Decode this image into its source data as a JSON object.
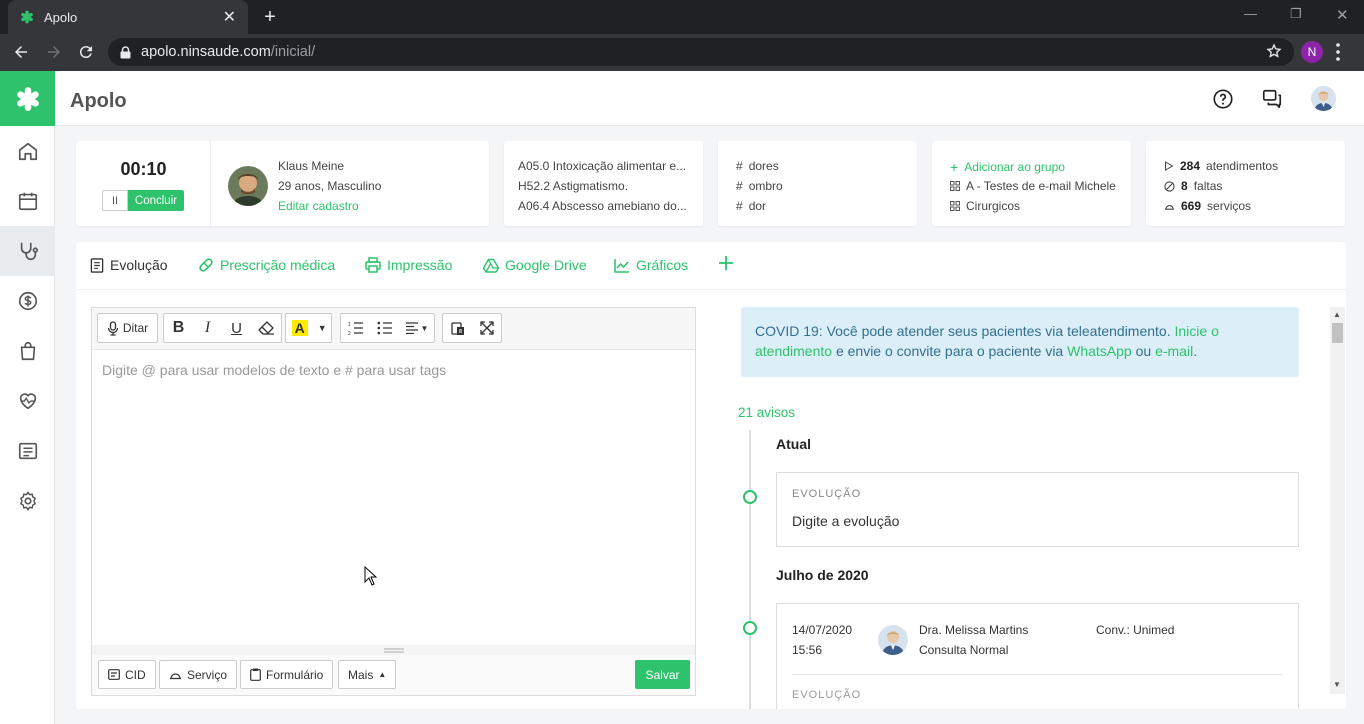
{
  "browser": {
    "tab_title": "Apolo",
    "url_host": "apolo.ninsaude.com",
    "url_path": "/inicial/",
    "profile_initial": "N"
  },
  "app": {
    "title": "Apolo",
    "sidebar": [
      "home-icon",
      "calendar-icon",
      "stethoscope-icon",
      "dollar-icon",
      "bag-icon",
      "heartbeat-icon",
      "document-list-icon",
      "gear-icon"
    ],
    "active_sidebar": "stethoscope-icon",
    "accent": "#2dc26b"
  },
  "timer": {
    "time": "00:10",
    "pause_label": "II",
    "finish_label": "Concluir"
  },
  "patient": {
    "name": "Klaus Meine",
    "info": "29 anos, Masculino",
    "edit_link": "Editar cadastro"
  },
  "diagnoses": [
    "A05.0 Intoxicação alimentar e...",
    "H52.2 Astigmatismo.",
    "A06.4 Abscesso amebiano do..."
  ],
  "tags": [
    "dores",
    "ombro",
    "dor"
  ],
  "groups": {
    "add_label": "Adicionar ao grupo",
    "items": [
      "A - Testes de e-mail Michele",
      "Cirurgicos"
    ]
  },
  "stats": [
    {
      "value": "284",
      "label": "atendimentos"
    },
    {
      "value": "8",
      "label": "faltas"
    },
    {
      "value": "669",
      "label": "serviços"
    }
  ],
  "tabs": [
    "Evolução",
    "Prescrição médica",
    "Impressão",
    "Google Drive",
    "Gráficos"
  ],
  "editor": {
    "dictate_label": "Ditar",
    "placeholder": "Digite @ para usar modelos de texto e # para usar tags",
    "footer": {
      "cid": "CID",
      "servico": "Serviço",
      "formulario": "Formulário",
      "mais": "Mais",
      "salvar": "Salvar"
    }
  },
  "covid": {
    "prefix": "COVID 19: Você pode atender seus pacientes via teleatendimento. ",
    "link1": "Inicie o atendimento",
    "mid": " e envie o convite para o paciente via ",
    "link2": "WhatsApp",
    "or": " ou ",
    "link3": "e-mail",
    "end": "."
  },
  "timeline": {
    "avisos": "21 avisos",
    "current_section": "Atual",
    "current_card_label": "EVOLUÇÃO",
    "current_card_text": "Digite a evolução",
    "month_section": "Julho de 2020",
    "entry": {
      "date": "14/07/2020",
      "time": "15:56",
      "doctor": "Dra. Melissa Martins",
      "type": "Consulta Normal",
      "insurance": "Conv.: Unimed",
      "next_label": "EVOLUÇÃO"
    }
  }
}
